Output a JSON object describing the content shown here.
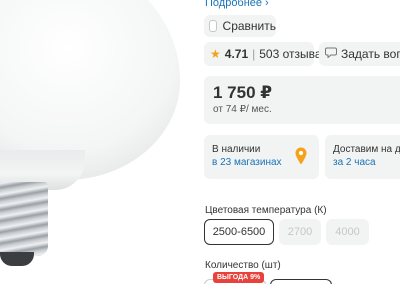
{
  "product": {
    "more_link": "Подробнее",
    "compare_label": "Сравнить",
    "rating": "4.71",
    "rating_separator": "|",
    "reviews": "503 отзыва",
    "question_label": "Задать вопр",
    "price": "1 750 ₽",
    "installment": "от 74 ₽/ мес.",
    "stock_title": "В наличии",
    "stock_link": "в 23 магазинах",
    "delivery_title": "Доставим на до",
    "delivery_link": "за 2 часа",
    "color_temp_label": "Цветовая температура (К)",
    "color_temp_options": [
      "2500-6500",
      "2700",
      "4000"
    ],
    "quantity_label": "Количество (шт)",
    "sale_badge": "ВЫГОДА 9%"
  },
  "icons": {
    "more_chevron": "chevron-right-icon",
    "compare": "checkbox-icon",
    "star": "star-icon",
    "question": "chat-bubble-icon",
    "stock": "map-pin-icon"
  },
  "colors": {
    "accent_link": "#1a73b8",
    "star": "#f4a21a",
    "pin": "#f4a21a",
    "sale_badge": "#e8423d",
    "chip_bg": "#f2f3f3"
  }
}
